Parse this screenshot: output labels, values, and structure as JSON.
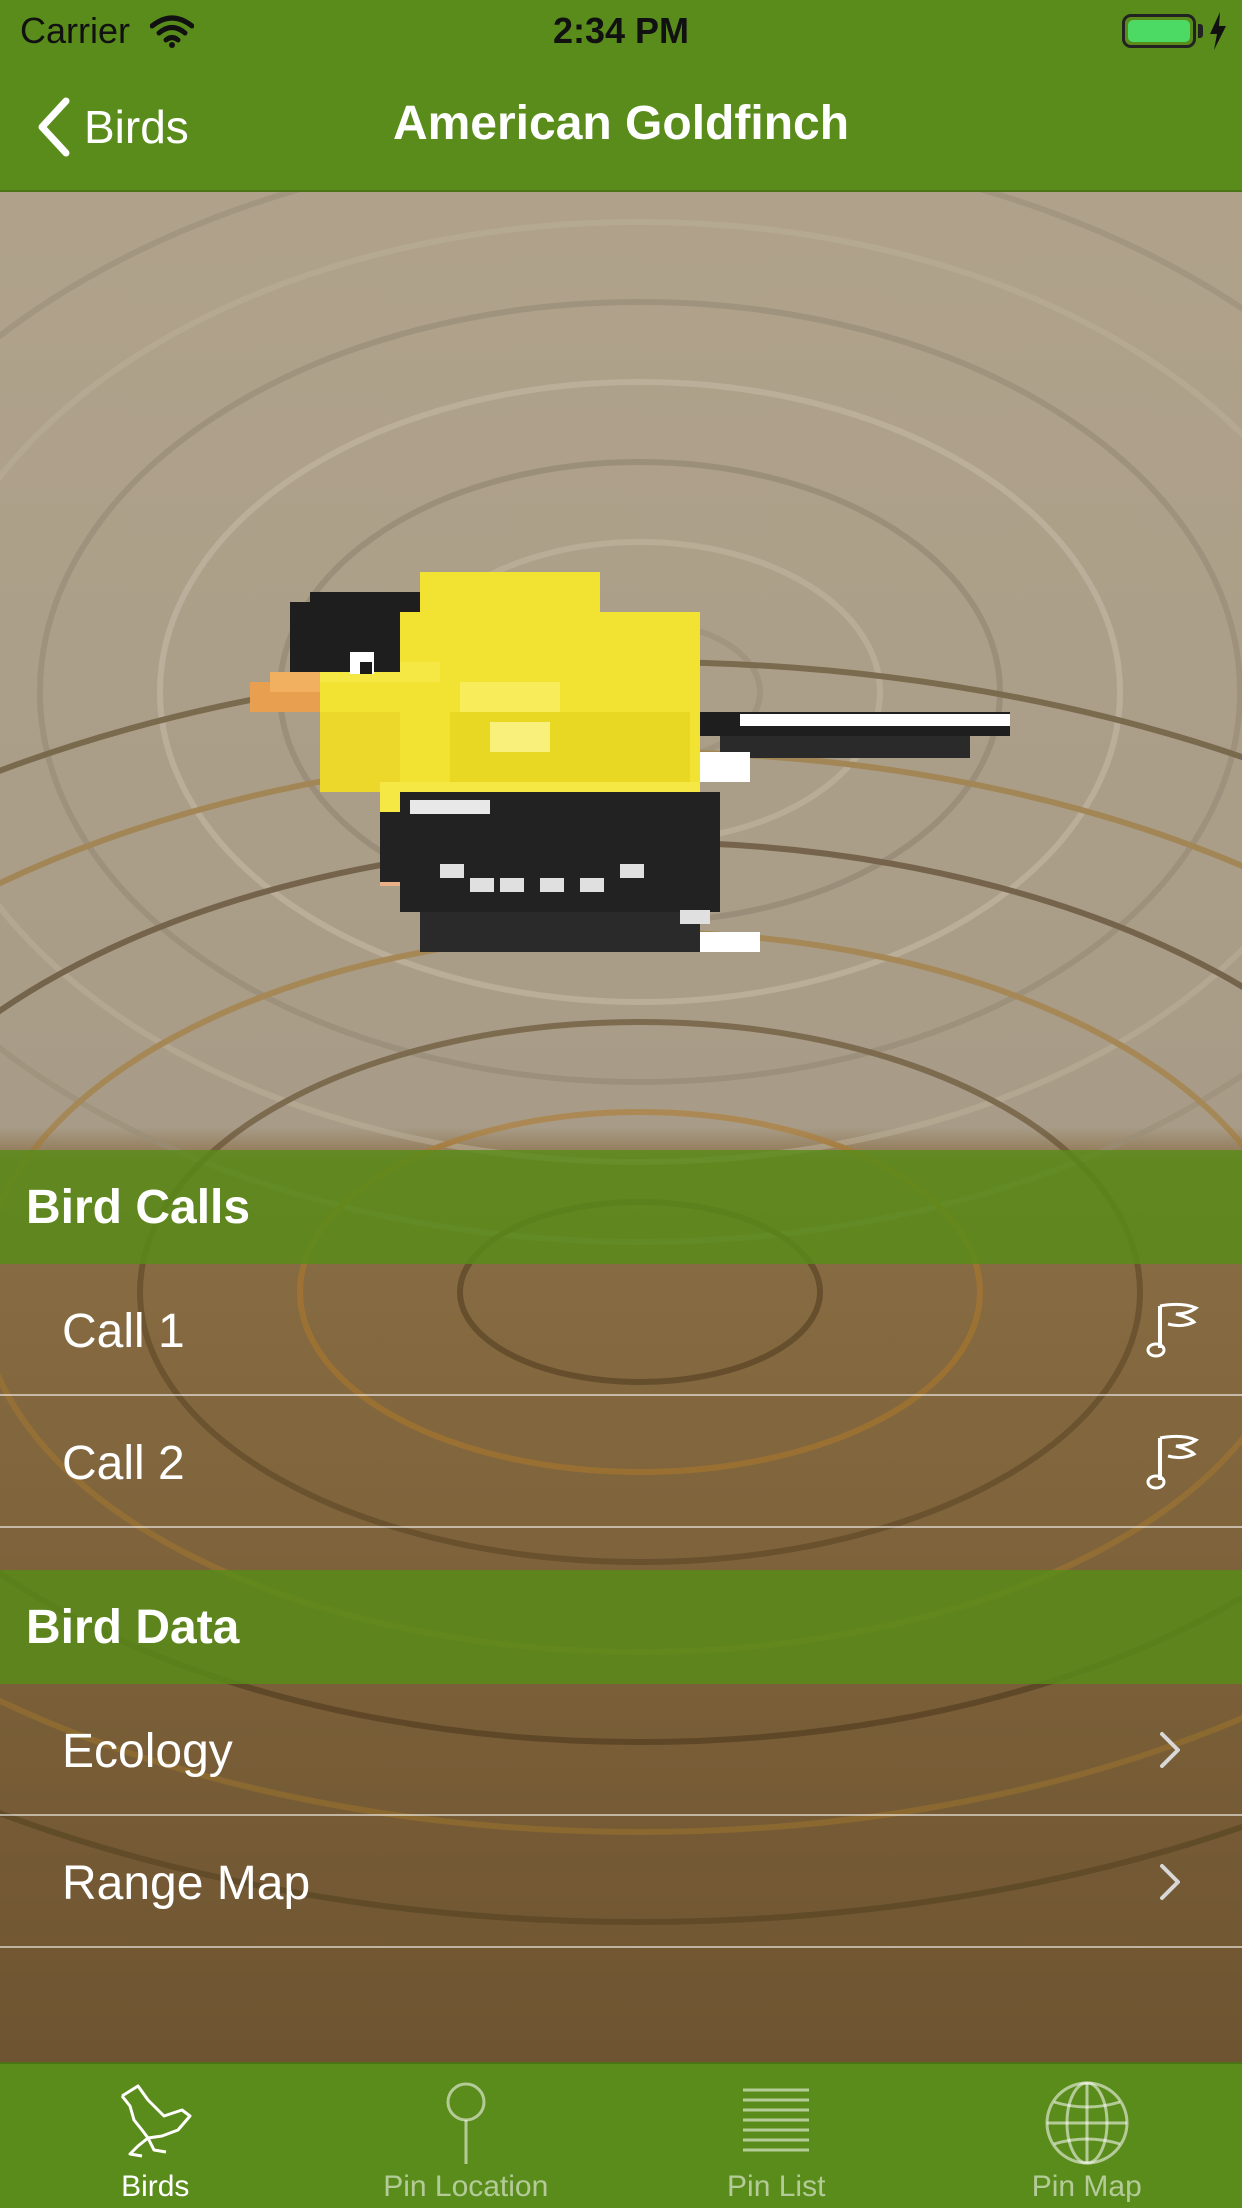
{
  "status_bar": {
    "carrier": "Carrier",
    "time": "2:34 PM",
    "battery_level": 1.0
  },
  "nav": {
    "back_label": "Birds",
    "title": "American Goldfinch"
  },
  "sections": [
    {
      "header": "Bird Calls",
      "rows": [
        {
          "label": "Call 1",
          "accessory": "music-note-icon"
        },
        {
          "label": "Call 2",
          "accessory": "music-note-icon"
        }
      ]
    },
    {
      "header": "Bird Data",
      "rows": [
        {
          "label": "Ecology",
          "accessory": "chevron-right-icon"
        },
        {
          "label": "Range Map",
          "accessory": "chevron-right-icon"
        }
      ]
    }
  ],
  "tab_bar": {
    "tabs": [
      {
        "label": "Birds",
        "icon": "bird-icon",
        "active": true
      },
      {
        "label": "Pin Location",
        "icon": "pin-icon",
        "active": false
      },
      {
        "label": "Pin List",
        "icon": "list-icon",
        "active": false
      },
      {
        "label": "Pin Map",
        "icon": "globe-icon",
        "active": false
      }
    ]
  },
  "colors": {
    "bar_green": "#5a8c1c",
    "section_green": "#588c18",
    "goldfinch_yellow": "#f2e232",
    "nest_brown": "#8a6a3a",
    "nest_light": "#b2a48c"
  }
}
